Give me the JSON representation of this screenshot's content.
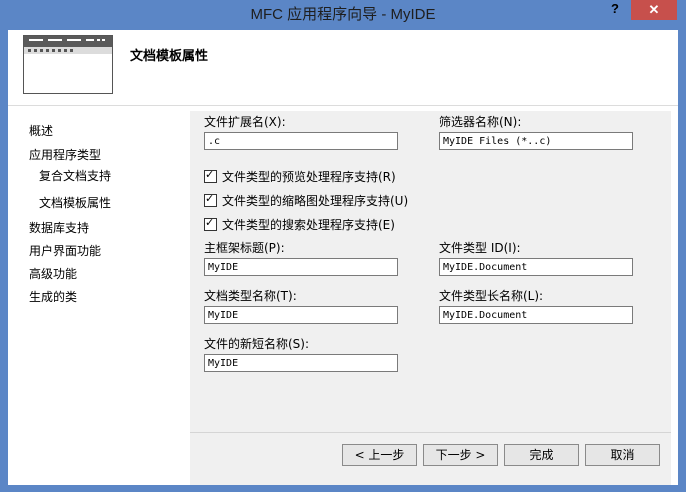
{
  "window": {
    "title": "MFC 应用程序向导 - MyIDE",
    "help": "?",
    "close": "✕"
  },
  "header": {
    "title": "文档模板属性"
  },
  "nav": {
    "items": [
      {
        "label": "概述"
      },
      {
        "label": "应用程序类型"
      },
      {
        "label": "复合文档支持"
      },
      {
        "label": "文档模板属性"
      },
      {
        "label": "数据库支持"
      },
      {
        "label": "用户界面功能"
      },
      {
        "label": "高级功能"
      },
      {
        "label": "生成的类"
      }
    ]
  },
  "form": {
    "file_ext_label": "文件扩展名(X):",
    "file_ext_value": ".c",
    "filter_name_label": "筛选器名称(N):",
    "filter_name_value": "MyIDE Files (*..c)",
    "chk_preview": "文件类型的预览处理程序支持(R)",
    "chk_thumbnail": "文件类型的缩略图处理程序支持(U)",
    "chk_search": "文件类型的搜索处理程序支持(E)",
    "main_frame_label": "主框架标题(P):",
    "main_frame_value": "MyIDE",
    "file_type_id_label": "文件类型 ID(I):",
    "file_type_id_value": "MyIDE.Document",
    "doc_type_name_label": "文档类型名称(T):",
    "doc_type_name_value": "MyIDE",
    "file_type_long_label": "文件类型长名称(L):",
    "file_type_long_value": "MyIDE.Document",
    "file_new_short_label": "文件的新短名称(S):",
    "file_new_short_value": "MyIDE"
  },
  "buttons": {
    "prev": "< 上一步",
    "next": "下一步 >",
    "finish": "完成",
    "cancel": "取消"
  }
}
